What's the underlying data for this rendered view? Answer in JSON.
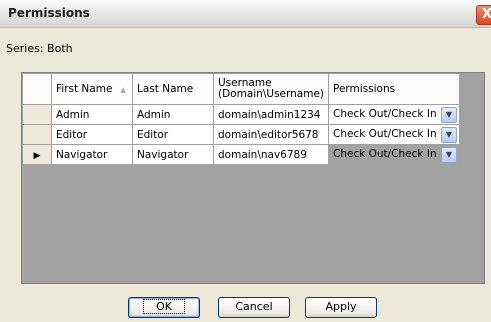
{
  "window": {
    "title": "Permissions",
    "close_glyph": "X"
  },
  "series": {
    "label": "Series:",
    "value": "Both"
  },
  "grid": {
    "columns": [
      "First Name",
      "Last Name",
      "Username",
      "(Domain\\Username)",
      "Permissions"
    ],
    "rows": [
      {
        "first": "Admin",
        "last": "Admin",
        "username": "domain\\admin1234",
        "permission": "Check Out/Check In"
      },
      {
        "first": "Editor",
        "last": "Editor",
        "username": "domain\\editor5678",
        "permission": "Check Out/Check In"
      },
      {
        "first": "Navigator",
        "last": "Navigator",
        "username": "domain\\nav6789",
        "permission": "Check Out/Check In"
      }
    ],
    "current_row_pointer": "▶"
  },
  "buttons": {
    "ok": "OK",
    "cancel": "Cancel",
    "apply": "Apply"
  },
  "colors": {
    "grid_empty": "#a2a2a2",
    "window_bg": "#ece9d8",
    "close_red": "#d44a28"
  }
}
